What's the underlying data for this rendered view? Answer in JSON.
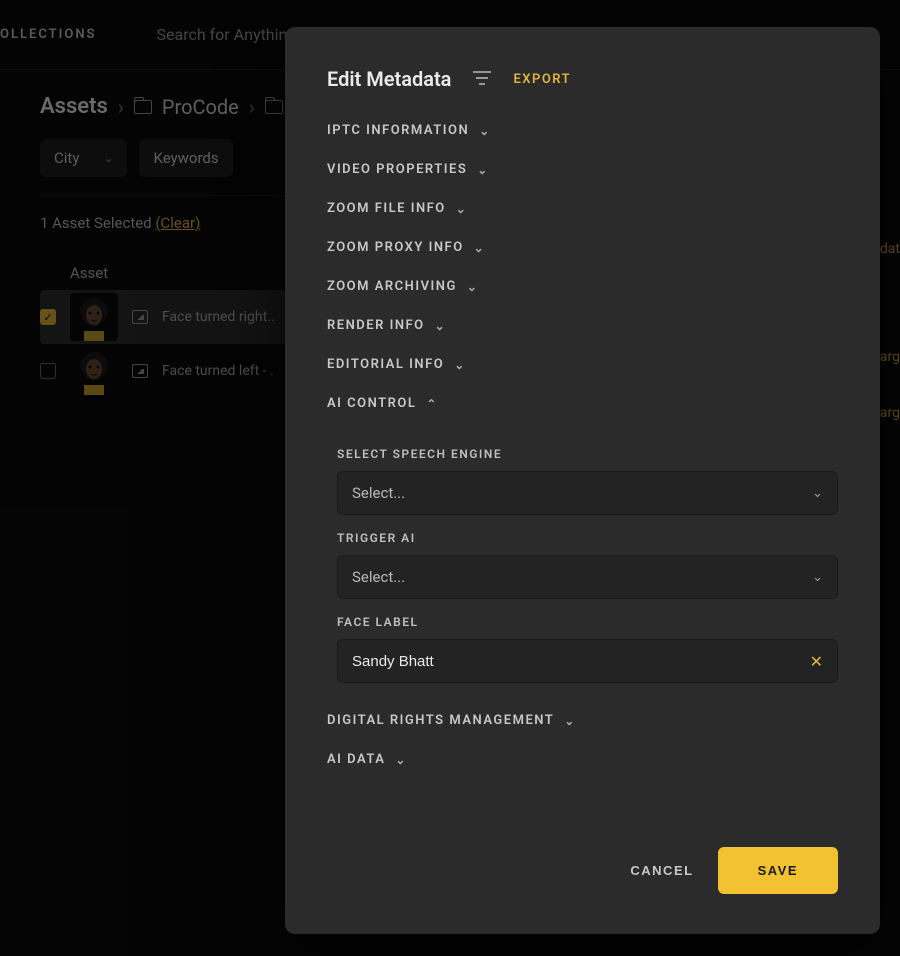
{
  "topbar": {
    "collections_tab": "OLLECTIONS",
    "search_placeholder": "Search for Anythin"
  },
  "breadcrumbs": {
    "root": "Assets",
    "folder": "ProCode"
  },
  "filters": {
    "city": "City",
    "keywords": "Keywords"
  },
  "selection": {
    "count_text": "1 Asset Selected ",
    "clear": "(Clear)"
  },
  "asset_header": "Asset",
  "right_labels": {
    "one": "dat",
    "two": "arg",
    "three": "arg"
  },
  "assets": [
    {
      "name": "Face turned right..",
      "checked": true
    },
    {
      "name": "Face turned left - .",
      "checked": false
    }
  ],
  "modal": {
    "title": "Edit Metadata",
    "export": "EXPORT",
    "sections": [
      "IPTC INFORMATION",
      "VIDEO PROPERTIES",
      "ZOOM FILE INFO",
      "ZOOM PROXY INFO",
      "ZOOM ARCHIVING",
      "RENDER INFO",
      "EDITORIAL INFO"
    ],
    "ai_section": "AI CONTROL",
    "ai": {
      "speech_label": "SELECT SPEECH ENGINE",
      "speech_value": "Select...",
      "trigger_label": "TRIGGER AI",
      "trigger_value": "Select...",
      "face_label_title": "FACE LABEL",
      "face_label_value": "Sandy Bhatt"
    },
    "bottom_sections": [
      "DIGITAL RIGHTS MANAGEMENT",
      "AI DATA"
    ],
    "cancel": "CANCEL",
    "save": "SAVE"
  }
}
